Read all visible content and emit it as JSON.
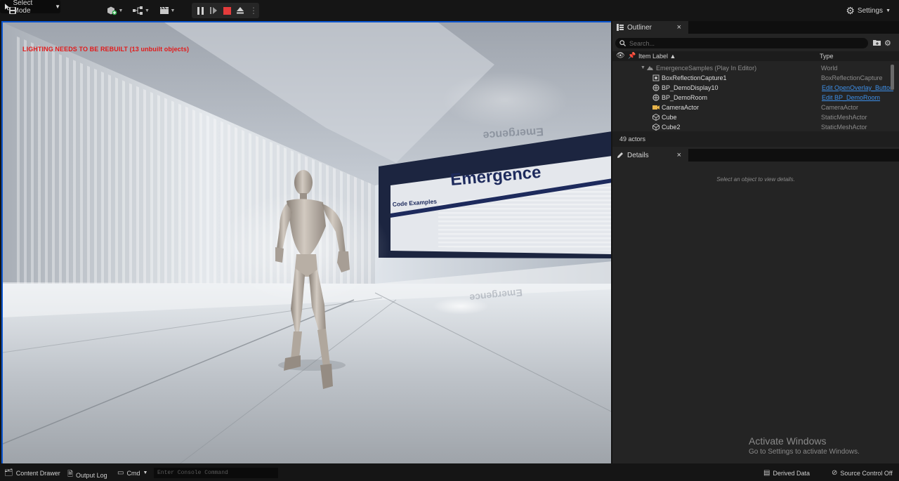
{
  "toolbar": {
    "select_mode_label": "Select Mode",
    "settings_label": "Settings"
  },
  "viewport": {
    "warning_text": "LIGHTING NEEDS TO BE REBUILT (13 unbuilt objects)",
    "wall_title": "Emergence",
    "wall_subtitle": "Code Examples",
    "reflection_title": "Emergence"
  },
  "outliner": {
    "tab_label": "Outliner",
    "search_placeholder": "Search...",
    "column_label": "Item Label",
    "column_type": "Type",
    "rows": [
      {
        "label": "EmergenceSamples (Play In Editor)",
        "type": "World",
        "icon": "world-icon",
        "link": false
      },
      {
        "label": "BoxReflectionCapture1",
        "type": "BoxReflectionCapture",
        "icon": "reflection-capture-icon",
        "link": false
      },
      {
        "label": "BP_DemoDisplay10",
        "type": "Edit OpenOverlay_Button",
        "icon": "blueprint-actor-icon",
        "link": true
      },
      {
        "label": "BP_DemoRoom",
        "type": "Edit BP_DemoRoom",
        "icon": "blueprint-actor-icon",
        "link": true
      },
      {
        "label": "CameraActor",
        "type": "CameraActor",
        "icon": "camera-icon",
        "link": false
      },
      {
        "label": "Cube",
        "type": "StaticMeshActor",
        "icon": "static-mesh-icon",
        "link": false
      },
      {
        "label": "Cube2",
        "type": "StaticMeshActor",
        "icon": "static-mesh-icon",
        "link": false
      }
    ],
    "actor_count": "49 actors"
  },
  "details": {
    "tab_label": "Details",
    "empty_message": "Select an object to view details."
  },
  "watermark": {
    "title": "Activate Windows",
    "subtitle": "Go to Settings to activate Windows."
  },
  "statusbar": {
    "content_drawer": "Content Drawer",
    "output_log": "Output Log",
    "cmd": "Cmd",
    "console_placeholder": "Enter Console Command",
    "derived_data": "Derived Data",
    "source_control": "Source Control Off"
  },
  "colors": {
    "viewport_border": "#0b56d0",
    "stop_red": "#e33b3b",
    "warning_red": "#e21a1a",
    "link_blue": "#3d8fe8",
    "wall_navy": "#1d2a5c"
  }
}
